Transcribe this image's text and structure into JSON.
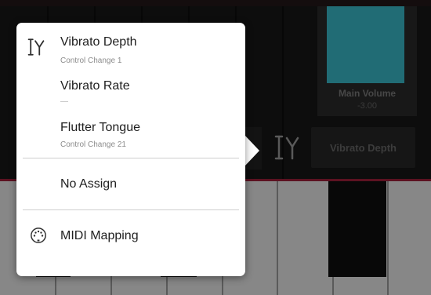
{
  "background": {
    "main_volume_label": "Main Volume",
    "main_volume_value": "-3.00",
    "assign_target_label": "Vibrato Depth",
    "icons": {
      "assign": "controller-assign-icon"
    }
  },
  "menu": {
    "items": [
      {
        "title": "Vibrato Depth",
        "subtitle": "Control Change 1",
        "icon": "controller-assign-icon",
        "selected": true
      },
      {
        "title": "Vibrato Rate",
        "subtitle": "—"
      },
      {
        "title": "Flutter Tongue",
        "subtitle": "Control Change 21"
      },
      {
        "title": "No Assign"
      },
      {
        "title": "MIDI Mapping",
        "icon": "midi-port-icon"
      }
    ]
  },
  "colors": {
    "accent_teal": "#33a6b4",
    "accent_red": "#8e1d33",
    "menu_bg": "#ffffff"
  }
}
